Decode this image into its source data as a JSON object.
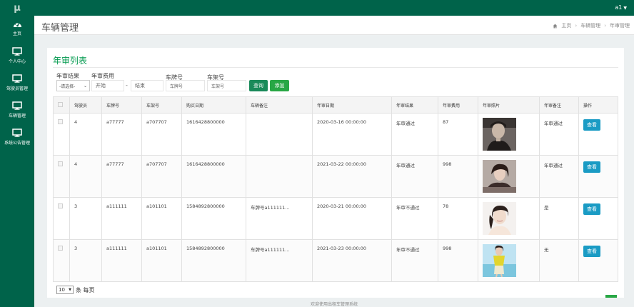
{
  "app": {
    "logo": "μ",
    "user": "a1"
  },
  "sidebar": {
    "items": [
      {
        "label": "主页",
        "icon": "dashboard-icon"
      },
      {
        "label": "个人中心",
        "icon": "monitor-icon"
      },
      {
        "label": "驾驶员管理",
        "icon": "monitor-icon"
      },
      {
        "label": "车辆管理",
        "icon": "monitor-icon"
      },
      {
        "label": "系统公告管理",
        "icon": "monitor-icon"
      }
    ]
  },
  "header": {
    "title": "车辆管理",
    "breadcrumb": [
      "主页",
      "车辆管理",
      "年审管理"
    ]
  },
  "panel": {
    "title": "年审列表"
  },
  "filters": {
    "result_label": "年审结果",
    "result_value": "-请选择-",
    "fee_label": "年审费用",
    "fee_start": "开始",
    "fee_end": "结束",
    "plate_label": "车牌号",
    "plate_placeholder": "车牌号",
    "frame_label": "车架号",
    "frame_placeholder": "车架号",
    "query_button": "查询",
    "add_button": "添加"
  },
  "table": {
    "headers": [
      "驾驶员",
      "车牌号",
      "车架号",
      "购买日期",
      "车辆备注",
      "年审日期",
      "年审结果",
      "年审费用",
      "年审照片",
      "年审备注",
      "操作"
    ],
    "rows": [
      {
        "driver": "4",
        "plate": "a77777",
        "frame": "a707707",
        "purchase": "1616428800000",
        "car_note": "",
        "date": "2020-03-16 00:00:00",
        "result": "年审通过",
        "fee": "87",
        "photo": "photo-1",
        "note": "年审通过",
        "action": "查看"
      },
      {
        "driver": "4",
        "plate": "a77777",
        "frame": "a707707",
        "purchase": "1616428800000",
        "car_note": "",
        "date": "2021-03-22 00:00:00",
        "result": "年审通过",
        "fee": "998",
        "photo": "photo-2",
        "note": "年审通过",
        "action": "查看"
      },
      {
        "driver": "3",
        "plate": "a111111",
        "frame": "a101101",
        "purchase": "1584892800000",
        "car_note": "车牌号a111111...",
        "date": "2020-03-21 00:00:00",
        "result": "年审不通过",
        "fee": "78",
        "photo": "photo-3",
        "note": "是",
        "action": "查看"
      },
      {
        "driver": "3",
        "plate": "a111111",
        "frame": "a101101",
        "purchase": "1584892800000",
        "car_note": "车牌号a111111...",
        "date": "2021-03-23 00:00:00",
        "result": "年审不通过",
        "fee": "998",
        "photo": "photo-4",
        "note": "无",
        "action": "查看"
      }
    ]
  },
  "pager": {
    "page_size": "10",
    "suffix": "条 每页"
  },
  "footer": "欢迎使用出租车管理系统",
  "colors": {
    "brand": "#00634a",
    "accent": "#00994d",
    "button_info": "#1a9bc4"
  }
}
